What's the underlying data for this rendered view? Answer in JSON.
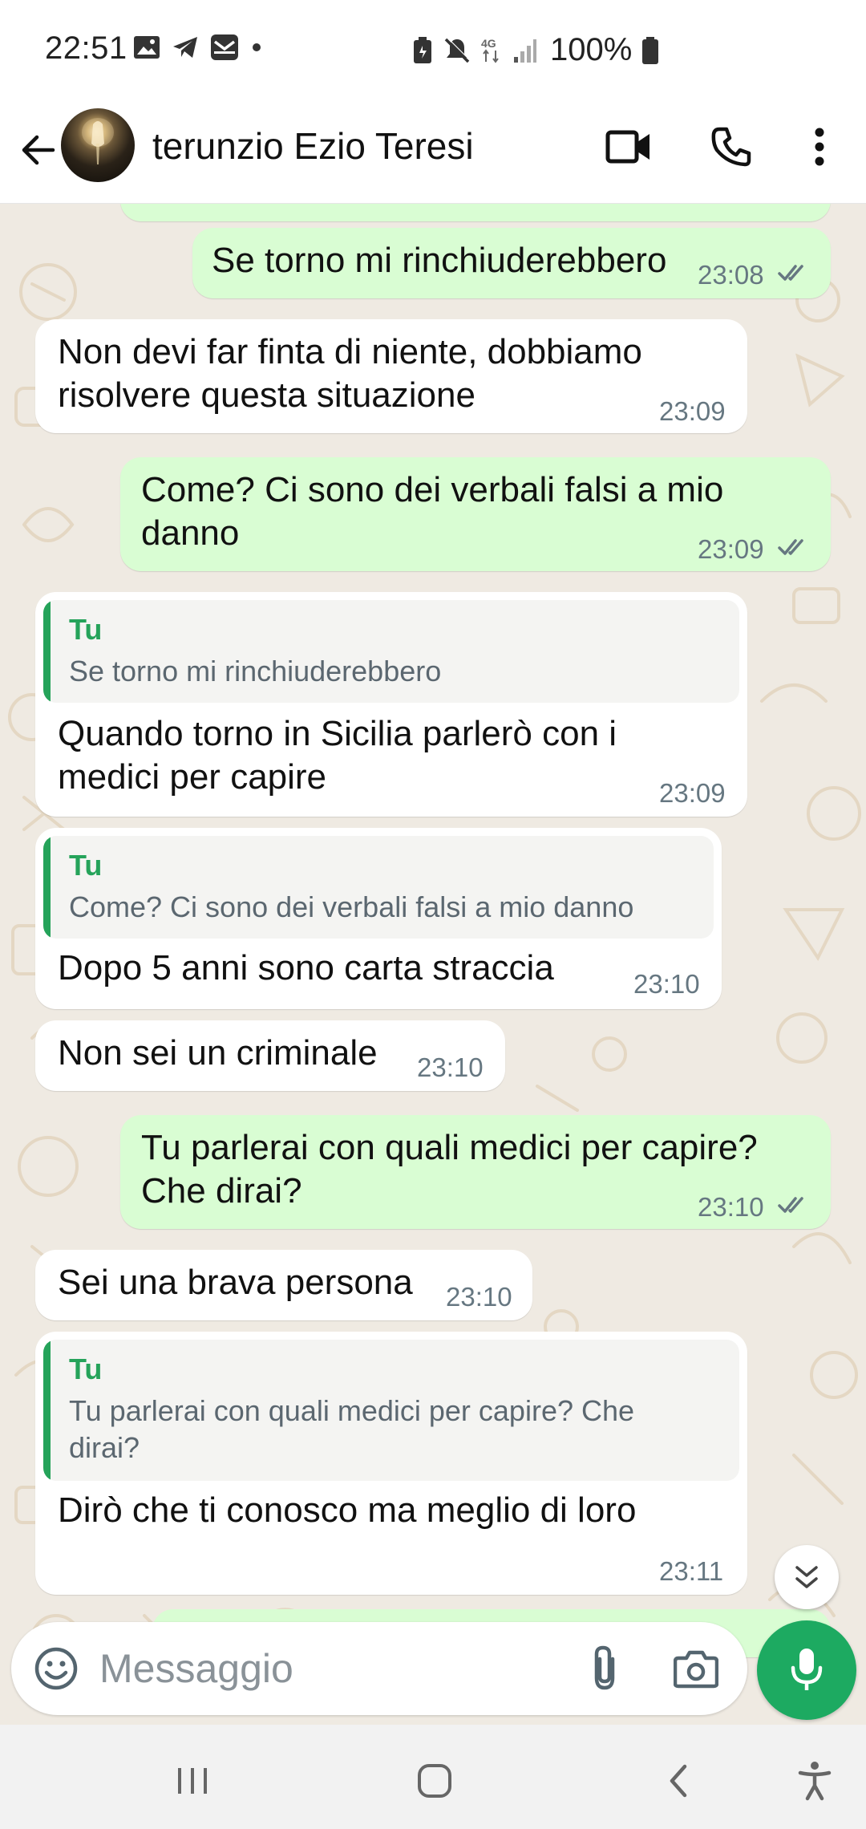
{
  "status_bar": {
    "time": "22:51",
    "battery": "100%",
    "left_icons": [
      "gallery-icon",
      "telegram-icon",
      "mail-icon",
      "dot-icon"
    ],
    "right_icons": [
      "battery-saver-icon",
      "mute-icon",
      "4g-icon",
      "signal-icon",
      "battery-icon"
    ]
  },
  "header": {
    "contact_name": "terunzio Ezio Teresi",
    "actions": [
      "video-call-icon",
      "voice-call-icon",
      "more-options-icon"
    ]
  },
  "messages": [
    {
      "dir": "out",
      "text": [
        "Se torno mi rinchiuderebbero"
      ],
      "time": "23:08",
      "read": true
    },
    {
      "dir": "in",
      "text": [
        "Non devi far finta di niente, dobbiamo",
        "risolvere questa situazione"
      ],
      "time": "23:09"
    },
    {
      "dir": "out",
      "text": [
        "Come? Ci sono dei verbali falsi a mio",
        "danno"
      ],
      "time": "23:09",
      "read": true
    },
    {
      "dir": "in",
      "quote": {
        "author": "Tu",
        "text": [
          "Se torno mi rinchiuderebbero"
        ]
      },
      "text": [
        "Quando torno in Sicilia parlerò con i",
        "medici per capire"
      ],
      "time": "23:09"
    },
    {
      "dir": "in",
      "quote": {
        "author": "Tu",
        "text": [
          "Come? Ci sono dei verbali falsi a mio danno"
        ]
      },
      "text": [
        "Dopo 5 anni sono carta straccia"
      ],
      "time": "23:10"
    },
    {
      "dir": "in",
      "text": [
        "Non sei un criminale"
      ],
      "time": "23:10"
    },
    {
      "dir": "out",
      "text": [
        "Tu parlerai con quali medici per capire?",
        "Che dirai?"
      ],
      "time": "23:10",
      "read": true
    },
    {
      "dir": "in",
      "text": [
        "Sei una brava persona"
      ],
      "time": "23:10"
    },
    {
      "dir": "in",
      "quote": {
        "author": "Tu",
        "text": [
          "Tu parlerai con quali medici per capire? Che",
          "dirai?"
        ]
      },
      "text": [
        "Dirò che ti conosco ma meglio di loro"
      ],
      "time": "23:11"
    }
  ],
  "composer": {
    "placeholder": "Messaggio",
    "value": ""
  },
  "colors": {
    "outgoing_bubble": "#d9fdd3",
    "incoming_bubble": "#ffffff",
    "accent_green": "#1daa61",
    "chat_background": "#efeae2",
    "read_ticks": "#667781"
  }
}
